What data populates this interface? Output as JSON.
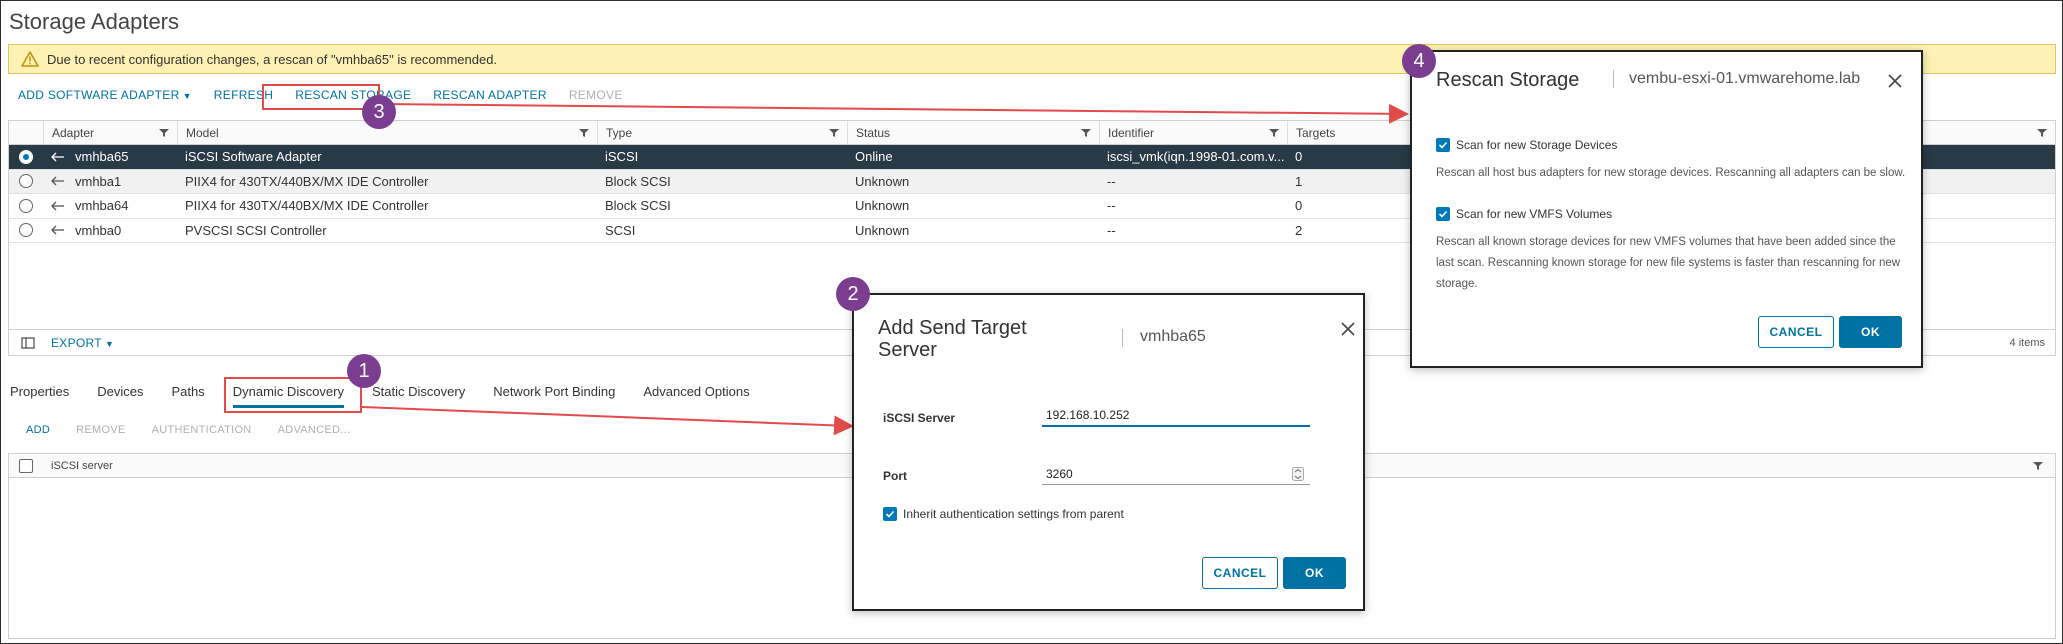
{
  "page": {
    "title": "Storage Adapters"
  },
  "warning": {
    "text": "Due to recent configuration changes, a rescan of \"vmhba65\" is recommended."
  },
  "toolbar": {
    "add_software_adapter": "ADD SOFTWARE ADAPTER",
    "refresh": "REFRESH",
    "rescan_storage": "RESCAN STORAGE",
    "rescan_adapter": "RESCAN ADAPTER",
    "remove": "REMOVE"
  },
  "adapters_grid": {
    "columns": [
      "Adapter",
      "Model",
      "Type",
      "Status",
      "Identifier",
      "Targets"
    ],
    "rows": [
      {
        "adapter": "vmhba65",
        "model": "iSCSI Software Adapter",
        "type": "iSCSI",
        "status": "Online",
        "identifier": "iscsi_vmk(iqn.1998-01.com.v...",
        "targets": "0",
        "selected": true
      },
      {
        "adapter": "vmhba1",
        "model": "PIIX4 for 430TX/440BX/MX IDE Controller",
        "type": "Block SCSI",
        "status": "Unknown",
        "identifier": "--",
        "targets": "1",
        "selected": false
      },
      {
        "adapter": "vmhba64",
        "model": "PIIX4 for 430TX/440BX/MX IDE Controller",
        "type": "Block SCSI",
        "status": "Unknown",
        "identifier": "--",
        "targets": "0",
        "selected": false
      },
      {
        "adapter": "vmhba0",
        "model": "PVSCSI SCSI Controller",
        "type": "SCSI",
        "status": "Unknown",
        "identifier": "--",
        "targets": "2",
        "selected": false
      }
    ],
    "export_label": "EXPORT",
    "item_count": "4 items"
  },
  "tabs": [
    "Properties",
    "Devices",
    "Paths",
    "Dynamic Discovery",
    "Static Discovery",
    "Network Port Binding",
    "Advanced Options"
  ],
  "active_tab": "Dynamic Discovery",
  "sub_toolbar": {
    "add": "ADD",
    "remove": "REMOVE",
    "authentication": "AUTHENTICATION",
    "advanced": "ADVANCED..."
  },
  "discovery_grid": {
    "column": "iSCSI server"
  },
  "callouts": [
    "1",
    "2",
    "3",
    "4"
  ],
  "add_target_dialog": {
    "title_line1": "Add Send Target",
    "title_line2": "Server",
    "subtitle": "vmhba65",
    "iscsi_server_label": "iSCSI Server",
    "iscsi_server_value": "192.168.10.252",
    "port_label": "Port",
    "port_value": "3260",
    "inherit_label": "Inherit authentication settings from parent",
    "cancel": "CANCEL",
    "ok": "OK"
  },
  "rescan_dialog": {
    "title": "Rescan Storage",
    "subtitle": "vembu-esxi-01.vmwarehome.lab",
    "option1_label": "Scan for new Storage Devices",
    "option1_desc": "Rescan all host bus adapters for new storage devices. Rescanning all adapters can be slow.",
    "option2_label": "Scan for new VMFS Volumes",
    "option2_desc": "Rescan all known storage devices for new VMFS volumes that have been added since the last scan. Rescanning known storage for new file systems is faster than rescanning for new storage.",
    "cancel": "CANCEL",
    "ok": "OK"
  },
  "colors": {
    "accent": "#0072a3",
    "callout": "#7b3d90",
    "highlight": "#e34a4a",
    "selected_row": "#283a45",
    "warning_bg": "#fdf1b4"
  }
}
